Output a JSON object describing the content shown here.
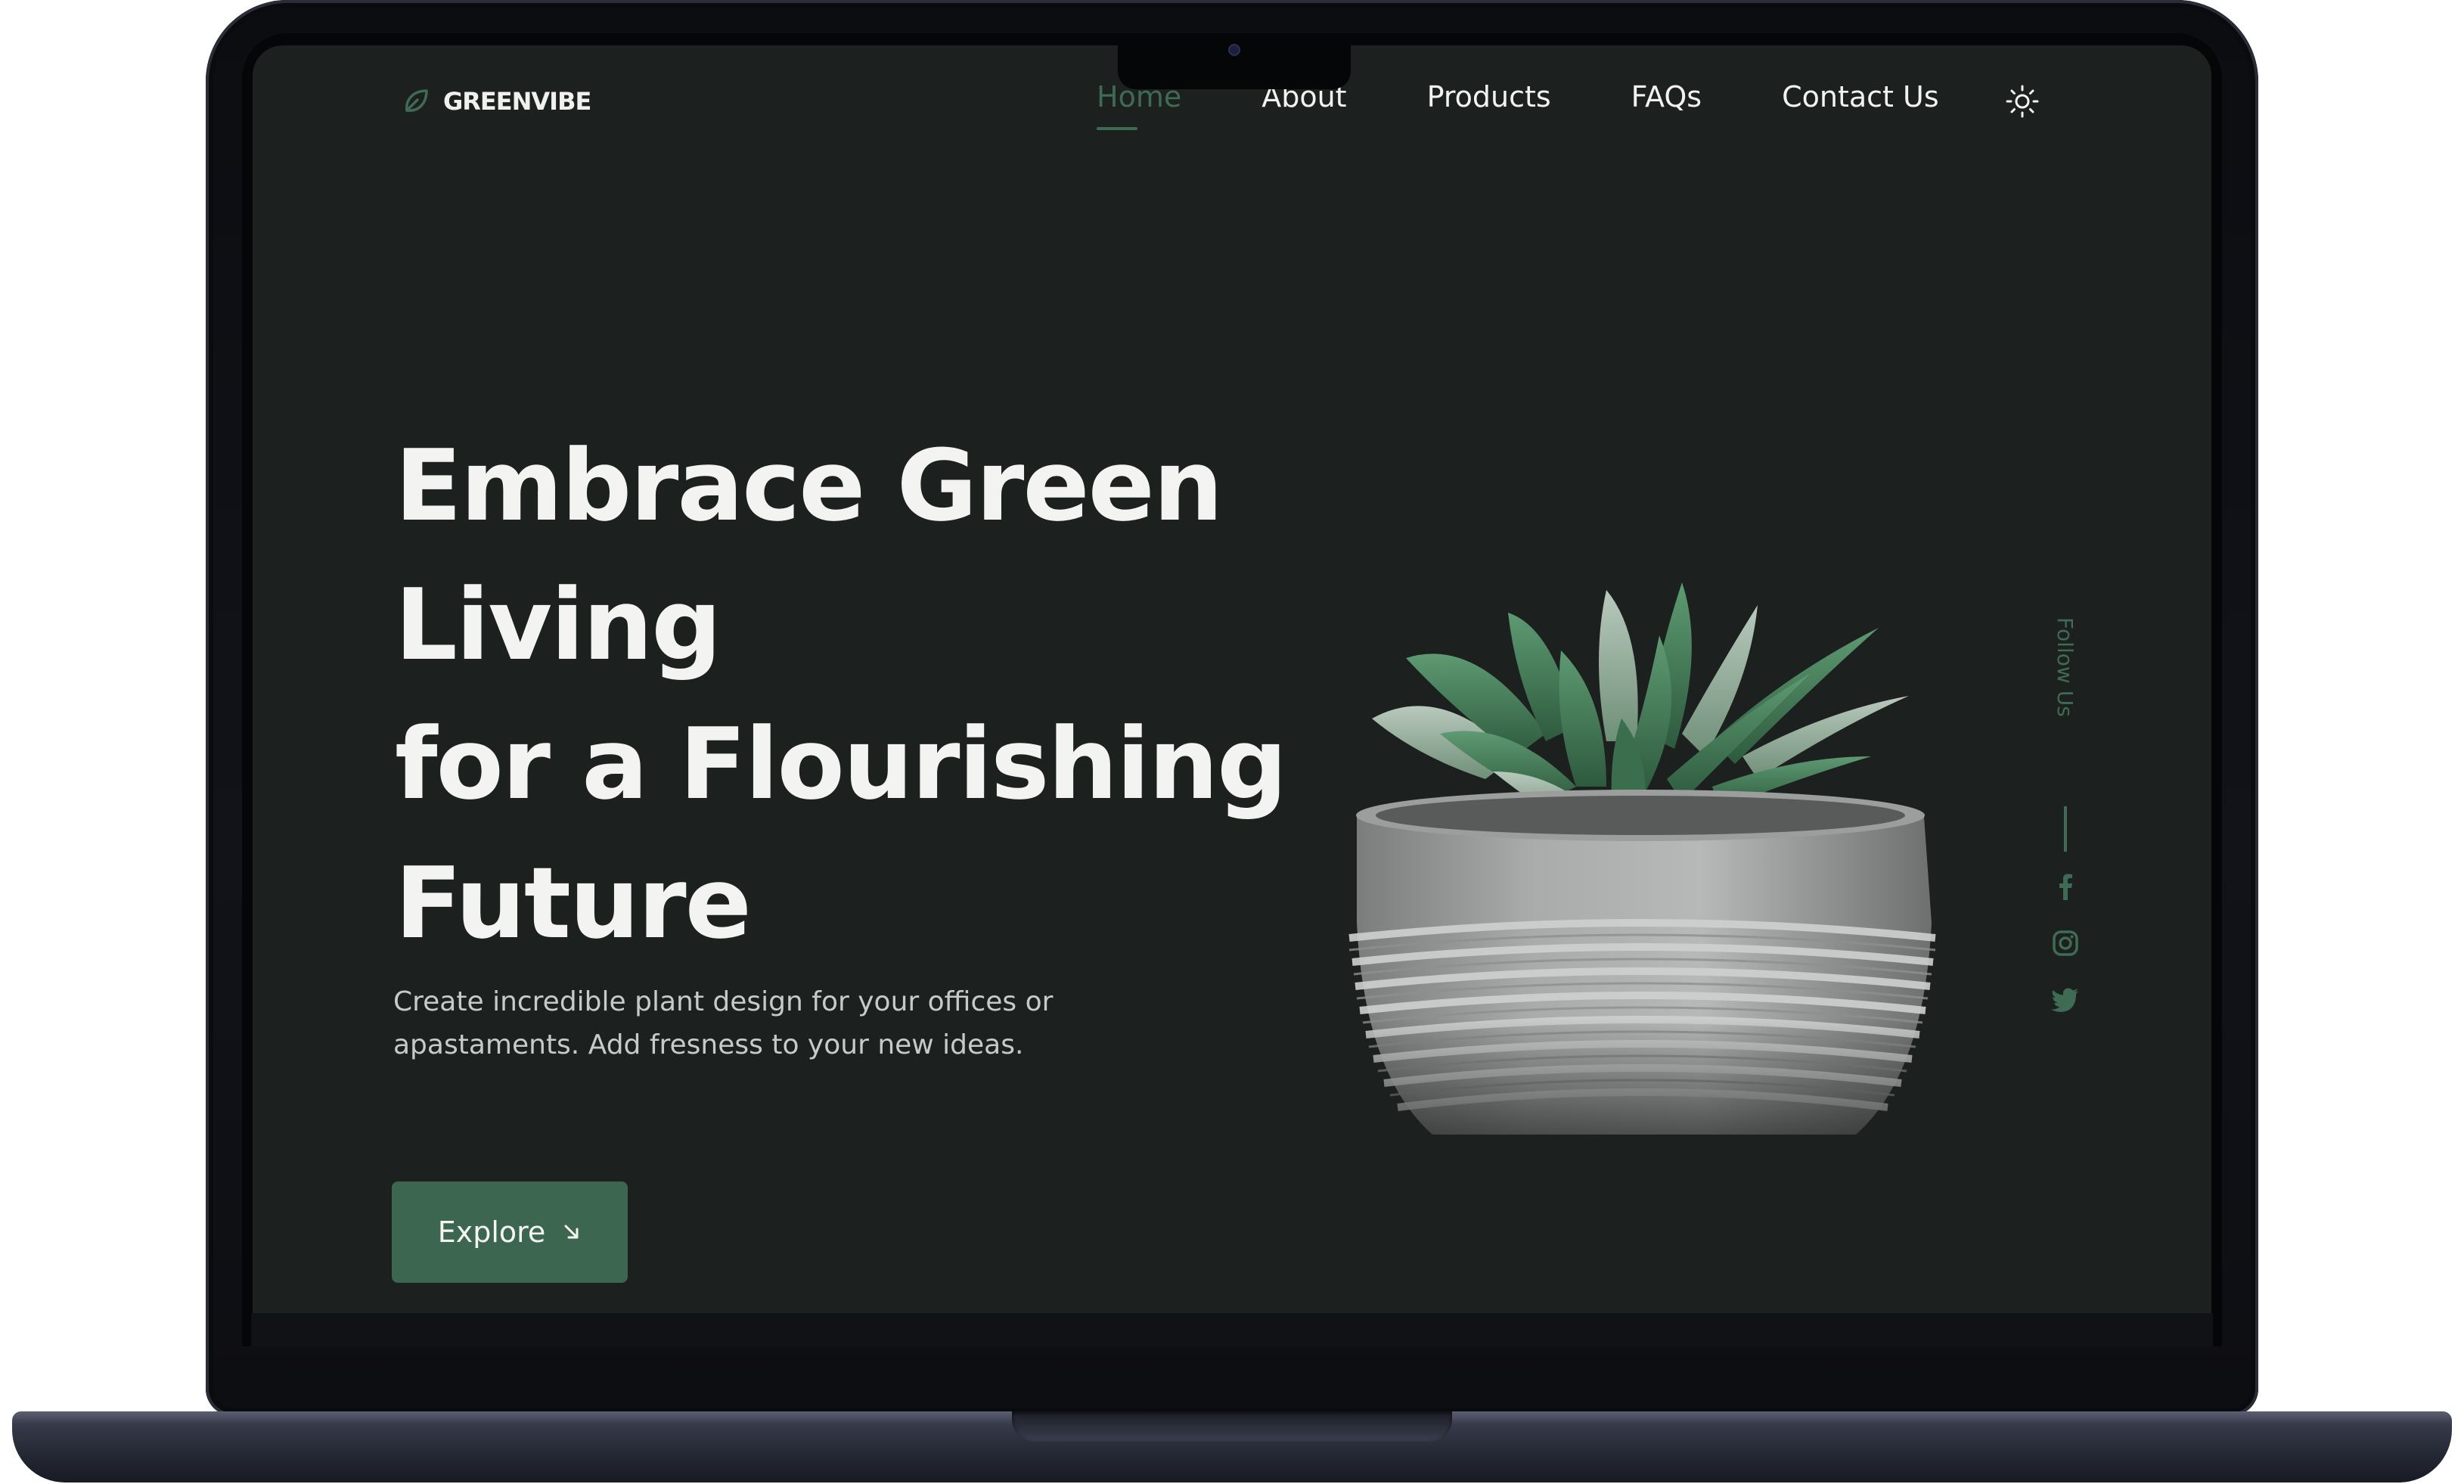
{
  "brand": {
    "name": "GREENVIBE",
    "icon": "leaf-icon"
  },
  "nav": {
    "items": [
      {
        "label": "Home",
        "active": true
      },
      {
        "label": "About",
        "active": false
      },
      {
        "label": "Products",
        "active": false
      },
      {
        "label": "FAQs",
        "active": false
      },
      {
        "label": "Contact Us",
        "active": false
      }
    ],
    "theme_toggle_icon": "sun-icon"
  },
  "hero": {
    "title_lines": [
      "Embrace Green",
      "Living",
      "for a Flourishing",
      "Future"
    ],
    "subtitle": "Create incredible plant design for your offices or apastaments. Add fresness to your new ideas.",
    "cta_label": "Explore",
    "cta_icon": "arrow-down-right-icon",
    "image": "succulent-in-concrete-pot"
  },
  "social": {
    "label": "Follow Us",
    "icons": [
      "facebook-icon",
      "instagram-icon",
      "twitter-icon"
    ]
  },
  "colors": {
    "background": "#1c201f",
    "accent": "#3d6650",
    "active_nav": "#3f6a54",
    "text": "#f3f3f1",
    "muted_text": "#c7cbc8"
  }
}
